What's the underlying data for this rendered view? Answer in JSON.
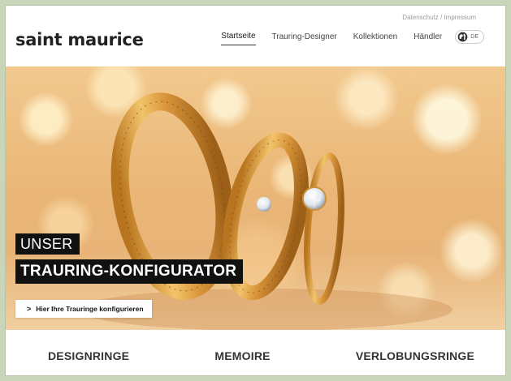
{
  "header": {
    "utility_links": "Datenschutz / Impressum",
    "logo": "saint maurice",
    "nav": [
      {
        "label": "Startseite",
        "active": true
      },
      {
        "label": "Trauring-Designer",
        "active": false
      },
      {
        "label": "Kollektionen",
        "active": false
      },
      {
        "label": "Händler",
        "active": false
      }
    ],
    "language": "DE"
  },
  "hero": {
    "headline_line1": "UNSER",
    "headline_line2": "TRAURING-KONFIGURATOR",
    "cta_label": "Hier Ihre Trauringe konfigurieren",
    "cta_icon": "chevron-right-icon"
  },
  "categories": [
    "DESIGNRINGE",
    "MEMOIRE",
    "VERLOBUNGSRINGE"
  ],
  "colors": {
    "page_border_bg": "#c9d5b9",
    "headline_bg": "#111111",
    "gold": "#e3a44c"
  }
}
